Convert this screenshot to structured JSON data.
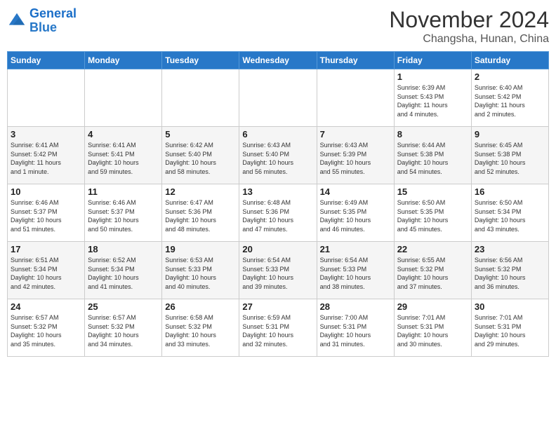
{
  "header": {
    "logo_line1": "General",
    "logo_line2": "Blue",
    "month": "November 2024",
    "location": "Changsha, Hunan, China"
  },
  "weekdays": [
    "Sunday",
    "Monday",
    "Tuesday",
    "Wednesday",
    "Thursday",
    "Friday",
    "Saturday"
  ],
  "weeks": [
    [
      {
        "day": "",
        "info": ""
      },
      {
        "day": "",
        "info": ""
      },
      {
        "day": "",
        "info": ""
      },
      {
        "day": "",
        "info": ""
      },
      {
        "day": "",
        "info": ""
      },
      {
        "day": "1",
        "info": "Sunrise: 6:39 AM\nSunset: 5:43 PM\nDaylight: 11 hours\nand 4 minutes."
      },
      {
        "day": "2",
        "info": "Sunrise: 6:40 AM\nSunset: 5:42 PM\nDaylight: 11 hours\nand 2 minutes."
      }
    ],
    [
      {
        "day": "3",
        "info": "Sunrise: 6:41 AM\nSunset: 5:42 PM\nDaylight: 11 hours\nand 1 minute."
      },
      {
        "day": "4",
        "info": "Sunrise: 6:41 AM\nSunset: 5:41 PM\nDaylight: 10 hours\nand 59 minutes."
      },
      {
        "day": "5",
        "info": "Sunrise: 6:42 AM\nSunset: 5:40 PM\nDaylight: 10 hours\nand 58 minutes."
      },
      {
        "day": "6",
        "info": "Sunrise: 6:43 AM\nSunset: 5:40 PM\nDaylight: 10 hours\nand 56 minutes."
      },
      {
        "day": "7",
        "info": "Sunrise: 6:43 AM\nSunset: 5:39 PM\nDaylight: 10 hours\nand 55 minutes."
      },
      {
        "day": "8",
        "info": "Sunrise: 6:44 AM\nSunset: 5:38 PM\nDaylight: 10 hours\nand 54 minutes."
      },
      {
        "day": "9",
        "info": "Sunrise: 6:45 AM\nSunset: 5:38 PM\nDaylight: 10 hours\nand 52 minutes."
      }
    ],
    [
      {
        "day": "10",
        "info": "Sunrise: 6:46 AM\nSunset: 5:37 PM\nDaylight: 10 hours\nand 51 minutes."
      },
      {
        "day": "11",
        "info": "Sunrise: 6:46 AM\nSunset: 5:37 PM\nDaylight: 10 hours\nand 50 minutes."
      },
      {
        "day": "12",
        "info": "Sunrise: 6:47 AM\nSunset: 5:36 PM\nDaylight: 10 hours\nand 48 minutes."
      },
      {
        "day": "13",
        "info": "Sunrise: 6:48 AM\nSunset: 5:36 PM\nDaylight: 10 hours\nand 47 minutes."
      },
      {
        "day": "14",
        "info": "Sunrise: 6:49 AM\nSunset: 5:35 PM\nDaylight: 10 hours\nand 46 minutes."
      },
      {
        "day": "15",
        "info": "Sunrise: 6:50 AM\nSunset: 5:35 PM\nDaylight: 10 hours\nand 45 minutes."
      },
      {
        "day": "16",
        "info": "Sunrise: 6:50 AM\nSunset: 5:34 PM\nDaylight: 10 hours\nand 43 minutes."
      }
    ],
    [
      {
        "day": "17",
        "info": "Sunrise: 6:51 AM\nSunset: 5:34 PM\nDaylight: 10 hours\nand 42 minutes."
      },
      {
        "day": "18",
        "info": "Sunrise: 6:52 AM\nSunset: 5:34 PM\nDaylight: 10 hours\nand 41 minutes."
      },
      {
        "day": "19",
        "info": "Sunrise: 6:53 AM\nSunset: 5:33 PM\nDaylight: 10 hours\nand 40 minutes."
      },
      {
        "day": "20",
        "info": "Sunrise: 6:54 AM\nSunset: 5:33 PM\nDaylight: 10 hours\nand 39 minutes."
      },
      {
        "day": "21",
        "info": "Sunrise: 6:54 AM\nSunset: 5:33 PM\nDaylight: 10 hours\nand 38 minutes."
      },
      {
        "day": "22",
        "info": "Sunrise: 6:55 AM\nSunset: 5:32 PM\nDaylight: 10 hours\nand 37 minutes."
      },
      {
        "day": "23",
        "info": "Sunrise: 6:56 AM\nSunset: 5:32 PM\nDaylight: 10 hours\nand 36 minutes."
      }
    ],
    [
      {
        "day": "24",
        "info": "Sunrise: 6:57 AM\nSunset: 5:32 PM\nDaylight: 10 hours\nand 35 minutes."
      },
      {
        "day": "25",
        "info": "Sunrise: 6:57 AM\nSunset: 5:32 PM\nDaylight: 10 hours\nand 34 minutes."
      },
      {
        "day": "26",
        "info": "Sunrise: 6:58 AM\nSunset: 5:32 PM\nDaylight: 10 hours\nand 33 minutes."
      },
      {
        "day": "27",
        "info": "Sunrise: 6:59 AM\nSunset: 5:31 PM\nDaylight: 10 hours\nand 32 minutes."
      },
      {
        "day": "28",
        "info": "Sunrise: 7:00 AM\nSunset: 5:31 PM\nDaylight: 10 hours\nand 31 minutes."
      },
      {
        "day": "29",
        "info": "Sunrise: 7:01 AM\nSunset: 5:31 PM\nDaylight: 10 hours\nand 30 minutes."
      },
      {
        "day": "30",
        "info": "Sunrise: 7:01 AM\nSunset: 5:31 PM\nDaylight: 10 hours\nand 29 minutes."
      }
    ]
  ]
}
